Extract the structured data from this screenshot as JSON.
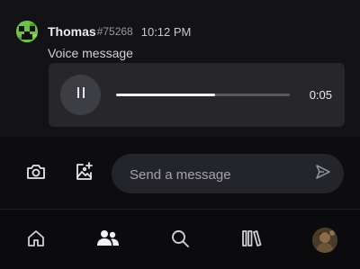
{
  "message": {
    "author": "Thomas",
    "tag": "#75268",
    "time": "10:12 PM",
    "text": "Voice message",
    "avatar_icon": "creeper-avatar-icon"
  },
  "voice": {
    "duration": "0:05",
    "progress": 0.57,
    "state": "playing",
    "control_icon": "pause-icon"
  },
  "composer": {
    "placeholder": "Send a message",
    "camera_icon": "camera-icon",
    "image_icon": "add-image-icon",
    "send_icon": "send-icon"
  },
  "nav": {
    "items": [
      "home-icon",
      "friends-icon",
      "search-icon",
      "library-icon",
      "profile-avatar"
    ],
    "active": "friends-icon"
  },
  "colors": {
    "background": "#0b0b0d",
    "chat_background": "#131316",
    "card": "#26262b",
    "input": "#24252b",
    "accent_text": "#ececee"
  }
}
